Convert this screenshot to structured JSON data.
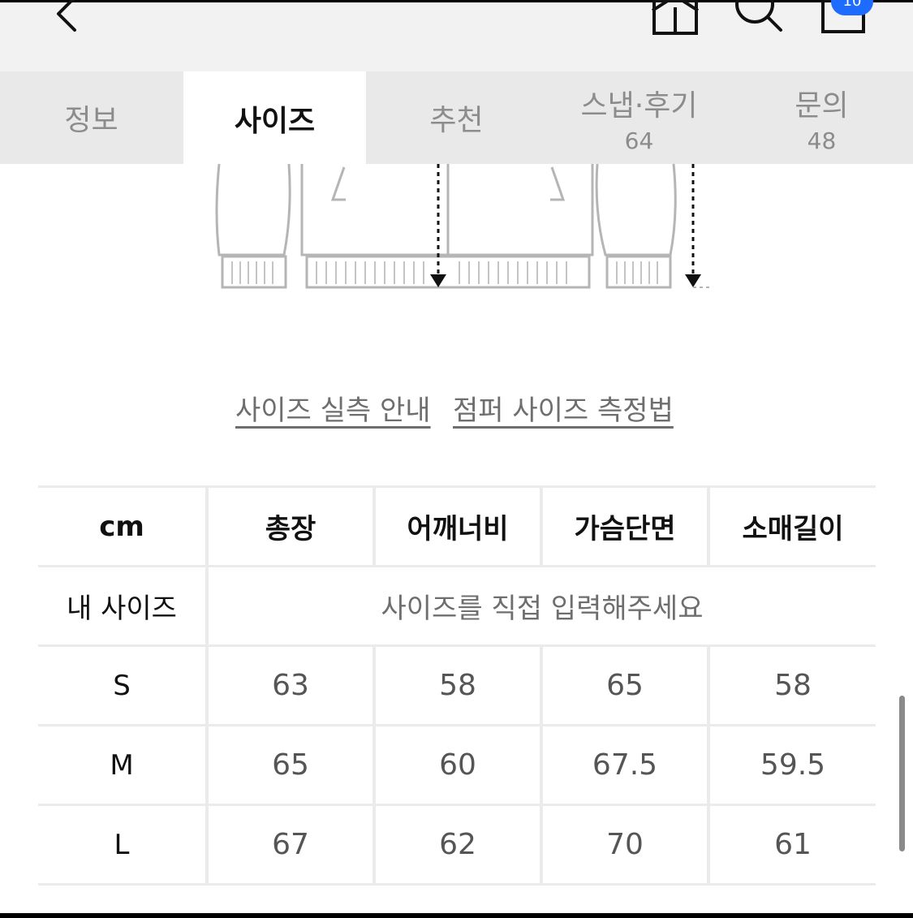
{
  "nav": {
    "icons": [
      "back-icon",
      "home-icon",
      "search-icon",
      "cart-icon"
    ],
    "cart_badge": "10"
  },
  "tabs": [
    {
      "label": "정보",
      "count": ""
    },
    {
      "label": "사이즈",
      "count": ""
    },
    {
      "label": "추천",
      "count": ""
    },
    {
      "label": "스냅·후기",
      "count": "64"
    },
    {
      "label": "문의",
      "count": "48"
    }
  ],
  "active_tab": "사이즈",
  "links": {
    "size_guide": "사이즈 실측 안내",
    "measure_method": "점퍼 사이즈 측정법"
  },
  "size_table": {
    "unit": "cm",
    "headers": [
      "총장",
      "어깨너비",
      "가슴단면",
      "소매길이"
    ],
    "my_size_label": "내 사이즈",
    "my_size_placeholder": "사이즈를 직접 입력해주세요",
    "rows": [
      {
        "size": "S",
        "values": [
          "63",
          "58",
          "65",
          "58"
        ]
      },
      {
        "size": "M",
        "values": [
          "65",
          "60",
          "67.5",
          "59.5"
        ]
      },
      {
        "size": "L",
        "values": [
          "67",
          "62",
          "70",
          "61"
        ]
      }
    ]
  },
  "colors": {
    "tab_bg": "#e9e9e9",
    "nav_bg": "#f2f2f2",
    "badge": "#1e6bff",
    "border": "#ebebeb",
    "muted_text": "#8c8c8c"
  }
}
